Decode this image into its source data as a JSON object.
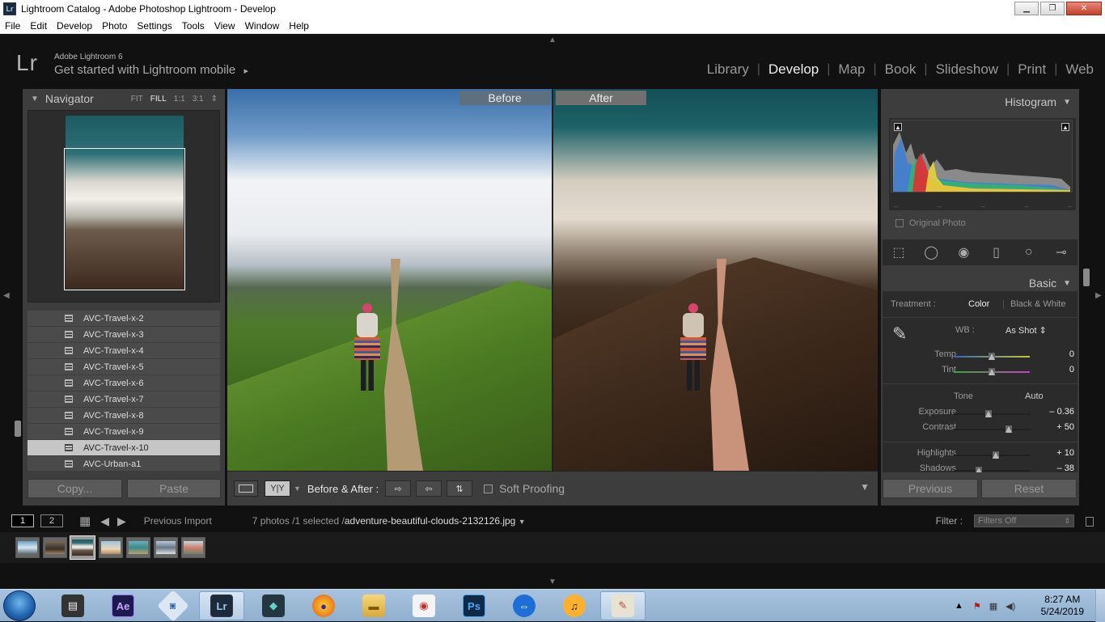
{
  "window": {
    "title": "Lightroom Catalog - Adobe Photoshop Lightroom - Develop",
    "app_icon": "Lr"
  },
  "menu": [
    "File",
    "Edit",
    "Develop",
    "Photo",
    "Settings",
    "Tools",
    "View",
    "Window",
    "Help"
  ],
  "identity": {
    "logo": "Lr",
    "version": "Adobe Lightroom 6",
    "mobile_text": "Get started with Lightroom mobile",
    "mobile_arrow": "▸"
  },
  "modules": [
    {
      "label": "Library",
      "active": false
    },
    {
      "label": "Develop",
      "active": true
    },
    {
      "label": "Map",
      "active": false
    },
    {
      "label": "Book",
      "active": false
    },
    {
      "label": "Slideshow",
      "active": false
    },
    {
      "label": "Print",
      "active": false
    },
    {
      "label": "Web",
      "active": false
    }
  ],
  "navigator": {
    "title": "Navigator",
    "zoom": [
      "FIT",
      "FILL",
      "1:1",
      "3:1"
    ],
    "zoom_active": "FILL"
  },
  "folders": [
    {
      "name": "AVC-Travel-x-2",
      "selected": false
    },
    {
      "name": "AVC-Travel-x-3",
      "selected": false
    },
    {
      "name": "AVC-Travel-x-4",
      "selected": false
    },
    {
      "name": "AVC-Travel-x-5",
      "selected": false
    },
    {
      "name": "AVC-Travel-x-6",
      "selected": false
    },
    {
      "name": "AVC-Travel-x-7",
      "selected": false
    },
    {
      "name": "AVC-Travel-x-8",
      "selected": false
    },
    {
      "name": "AVC-Travel-x-9",
      "selected": false
    },
    {
      "name": "AVC-Travel-x-10",
      "selected": true
    },
    {
      "name": "AVC-Urban-a1",
      "selected": false
    }
  ],
  "left_buttons": {
    "copy": "Copy...",
    "paste": "Paste"
  },
  "view": {
    "before_label": "Before",
    "after_label": "After"
  },
  "toolbar": {
    "yy_label": "Y|Y",
    "before_after_label": "Before & After :",
    "soft_proofing": "Soft Proofing"
  },
  "histogram": {
    "title": "Histogram",
    "original_photo": "Original Photo"
  },
  "basic": {
    "title": "Basic",
    "treatment_label": "Treatment :",
    "treatment_color": "Color",
    "treatment_bw": "Black & White",
    "wb_label": "WB :",
    "wb_value": "As Shot",
    "temp_label": "Temp",
    "temp_value": "0",
    "temp_pos": 0.5,
    "tint_label": "Tint",
    "tint_value": "0",
    "tint_pos": 0.5,
    "tone_label": "Tone",
    "auto_label": "Auto",
    "exposure_label": "Exposure",
    "exposure_value": "– 0.36",
    "exposure_pos": 0.46,
    "contrast_label": "Contrast",
    "contrast_value": "+ 50",
    "contrast_pos": 0.72,
    "highlights_label": "Highlights",
    "highlights_value": "+ 10",
    "highlights_pos": 0.55,
    "shadows_label": "Shadows",
    "shadows_value": "– 38",
    "shadows_pos": 0.33
  },
  "right_buttons": {
    "previous": "Previous",
    "reset": "Reset"
  },
  "filmstrip_header": {
    "page1": "1",
    "page2": "2",
    "source": "Previous Import",
    "count": "7 photos /1 selected /",
    "filename": "adventure-beautiful-clouds-2132126.jpg",
    "filter_label": "Filter :",
    "filter_value": "Filters Off"
  },
  "taskbar": {
    "clock_time": "8:27 AM",
    "clock_date": "5/24/2019"
  },
  "colors": {
    "panel": "#3d3d3d",
    "panel_dark": "#2b2b2b",
    "selected_row": "#c6c6c6",
    "before_label_bg": "#5e6f80"
  }
}
